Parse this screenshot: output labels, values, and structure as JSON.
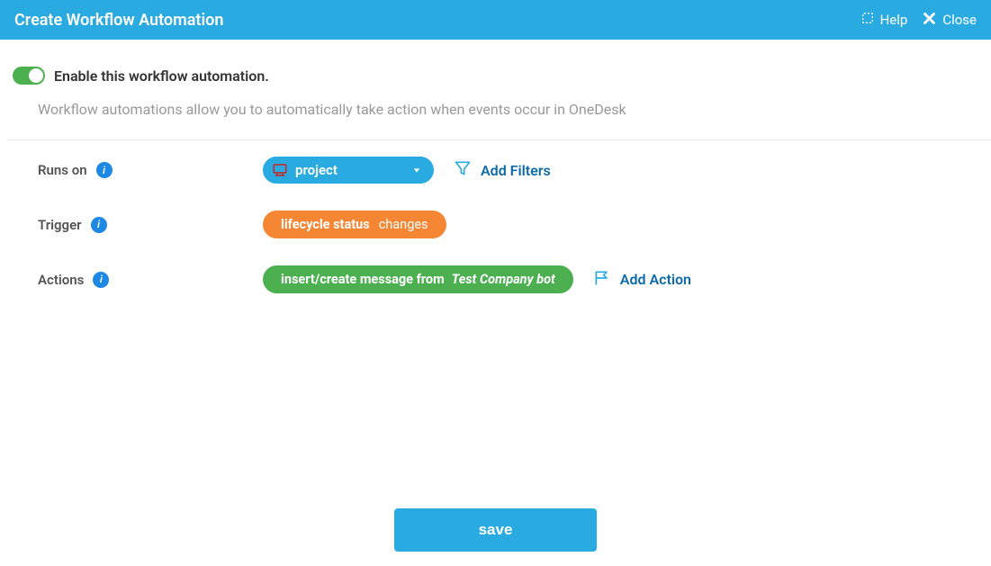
{
  "header": {
    "title": "Create Workflow Automation",
    "help": "Help",
    "close": "Close"
  },
  "enable": {
    "label": "Enable this workflow automation."
  },
  "description": "Workflow automations allow you to automatically take action when events occur in OneDesk",
  "runsOn": {
    "label": "Runs on",
    "value": "project",
    "addFilters": "Add Filters"
  },
  "trigger": {
    "label": "Trigger",
    "field": "lifecycle status",
    "condition": "changes"
  },
  "actions": {
    "label": "Actions",
    "actionText": "insert/create message from",
    "actionValue": "Test Company bot",
    "addAction": "Add Action"
  },
  "saveLabel": "save"
}
